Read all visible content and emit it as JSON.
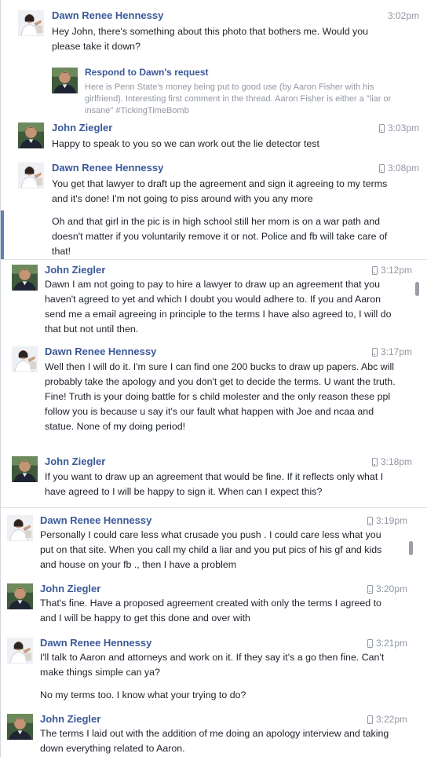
{
  "colors": {
    "sender": "#3b5998",
    "text": "#1d2129",
    "meta": "#9197a3",
    "active_bar": "#5f7fb6"
  },
  "icons": {
    "mobile": "mobile-phone-icon"
  },
  "conversation": {
    "messages": [
      {
        "sender": "Dawn Renee Hennessy",
        "time": "3:02pm",
        "mobile": false,
        "paragraphs": [
          "Hey John, there's something about this photo that bothers me. Would you please take it down?"
        ],
        "attachment": {
          "title": "Respond to Dawn's request",
          "text": "Here is Penn State's money being put to good use (by Aaron Fisher with his girlfriend). Interesting first comment in the thread. Aaron Fisher is either a \"liar or insane\" #TickingTimeBomb"
        }
      },
      {
        "sender": "John Ziegler",
        "time": "3:03pm",
        "mobile": true,
        "paragraphs": [
          "Happy to speak to you so we can work out the lie detector test"
        ]
      },
      {
        "sender": "Dawn Renee Hennessy",
        "time": "3:08pm",
        "mobile": true,
        "paragraphs": [
          "You get that lawyer to draft up the agreement and sign it agreeing to my terms and it's done! I'm not going to piss around with you any more",
          "Oh and that girl in the pic is in high school still her mom is on a war path and doesn't matter if you voluntarily remove it or not. Police and fb will take care of that!"
        ]
      },
      {
        "sender": "John Ziegler",
        "time": "3:12pm",
        "mobile": true,
        "paragraphs": [
          "Dawn I am not going to pay to hire a lawyer to draw up an agreement that you haven't agreed to yet and which I doubt you would adhere to. If you and Aaron send me a email agreeing in principle to the terms I have also agreed to, I will do that but not until then."
        ]
      },
      {
        "sender": "Dawn Renee Hennessy",
        "time": "3:17pm",
        "mobile": true,
        "paragraphs": [
          "Well then I will do it. I'm sure I can find one 200 bucks to draw up papers. Abc will probably take the apology and you don't get to decide the terms. U want the truth. Fine! Truth is your doing battle for s child molester and the only reason these ppl follow you is because u say it's our fault what happen with Joe and ncaa and statue. None of my doing period!"
        ]
      },
      {
        "sender": "John Ziegler",
        "time": "3:18pm",
        "mobile": true,
        "paragraphs": [
          "If you want to draw up an agreement that would be fine. If it reflects only what I have agreed to I will be happy to sign it. When can I expect this?"
        ]
      },
      {
        "sender": "Dawn Renee Hennessy",
        "time": "3:19pm",
        "mobile": true,
        "paragraphs": [
          "Personally I could care less what crusade you push . I could care less what you put on that site. When you call my child a liar and you put pics of his gf and kids and house on your fb ., then I have a problem"
        ]
      },
      {
        "sender": "John Ziegler",
        "time": "3:20pm",
        "mobile": true,
        "paragraphs": [
          "That's fine. Have a proposed agreement created with only the terms I agreed to and I will be happy to get this done and over with"
        ]
      },
      {
        "sender": "Dawn Renee Hennessy",
        "time": "3:21pm",
        "mobile": true,
        "paragraphs": [
          "I'll talk to Aaron and attorneys and work on it. If they say it's a go then fine. Can't make things simple can ya?",
          "No my terms too. I know what your trying to do?"
        ]
      },
      {
        "sender": "John Ziegler",
        "time": "3:22pm",
        "mobile": true,
        "paragraphs": [
          "The terms I laid out with the addition of me doing an apology interview and taking down everything related to Aaron."
        ]
      }
    ]
  }
}
